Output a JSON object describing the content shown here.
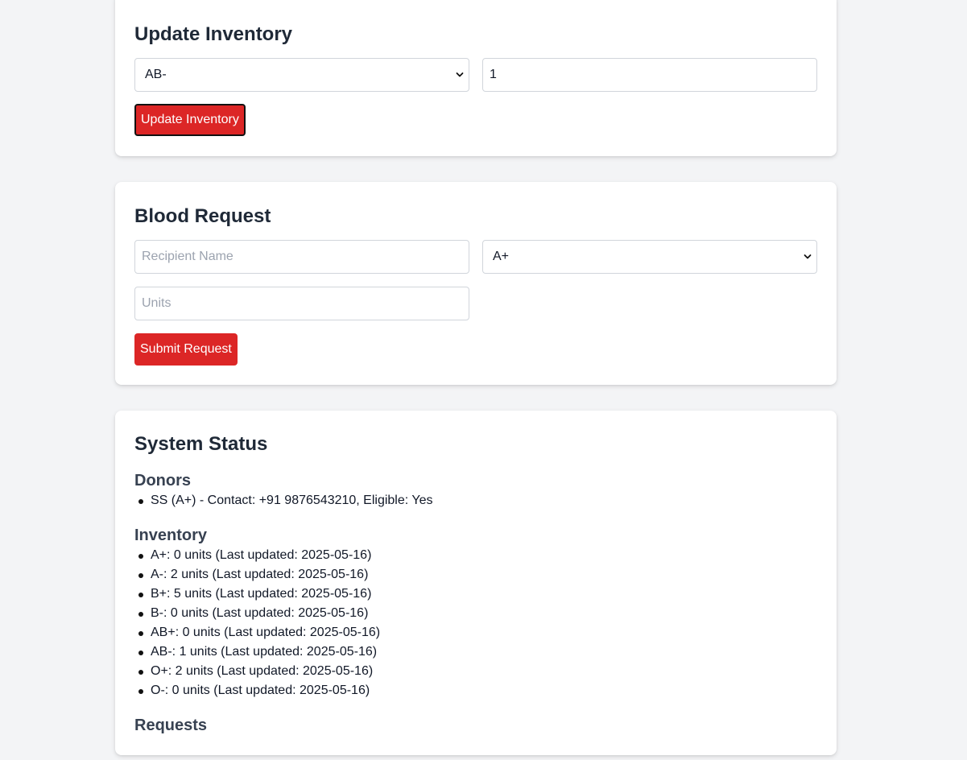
{
  "update_inventory": {
    "title": "Update Inventory",
    "blood_type_selected": "AB-",
    "units_value": "1",
    "button_label": "Update Inventory"
  },
  "blood_request": {
    "title": "Blood Request",
    "recipient_placeholder": "Recipient Name",
    "blood_type_selected": "A+",
    "units_placeholder": "Units",
    "button_label": "Submit Request"
  },
  "system_status": {
    "title": "System Status",
    "donors_heading": "Donors",
    "donors": [
      "SS (A+) - Contact: +91 9876543210, Eligible: Yes"
    ],
    "inventory_heading": "Inventory",
    "inventory": [
      "A+: 0 units (Last updated: 2025-05-16)",
      "A-: 2 units (Last updated: 2025-05-16)",
      "B+: 5 units (Last updated: 2025-05-16)",
      "B-: 0 units (Last updated: 2025-05-16)",
      "AB+: 0 units (Last updated: 2025-05-16)",
      "AB-: 1 units (Last updated: 2025-05-16)",
      "O+: 2 units (Last updated: 2025-05-16)",
      "O-: 0 units (Last updated: 2025-05-16)"
    ],
    "requests_heading": "Requests"
  },
  "colors": {
    "accent": "#dc2626",
    "background": "#f3f4f6"
  }
}
